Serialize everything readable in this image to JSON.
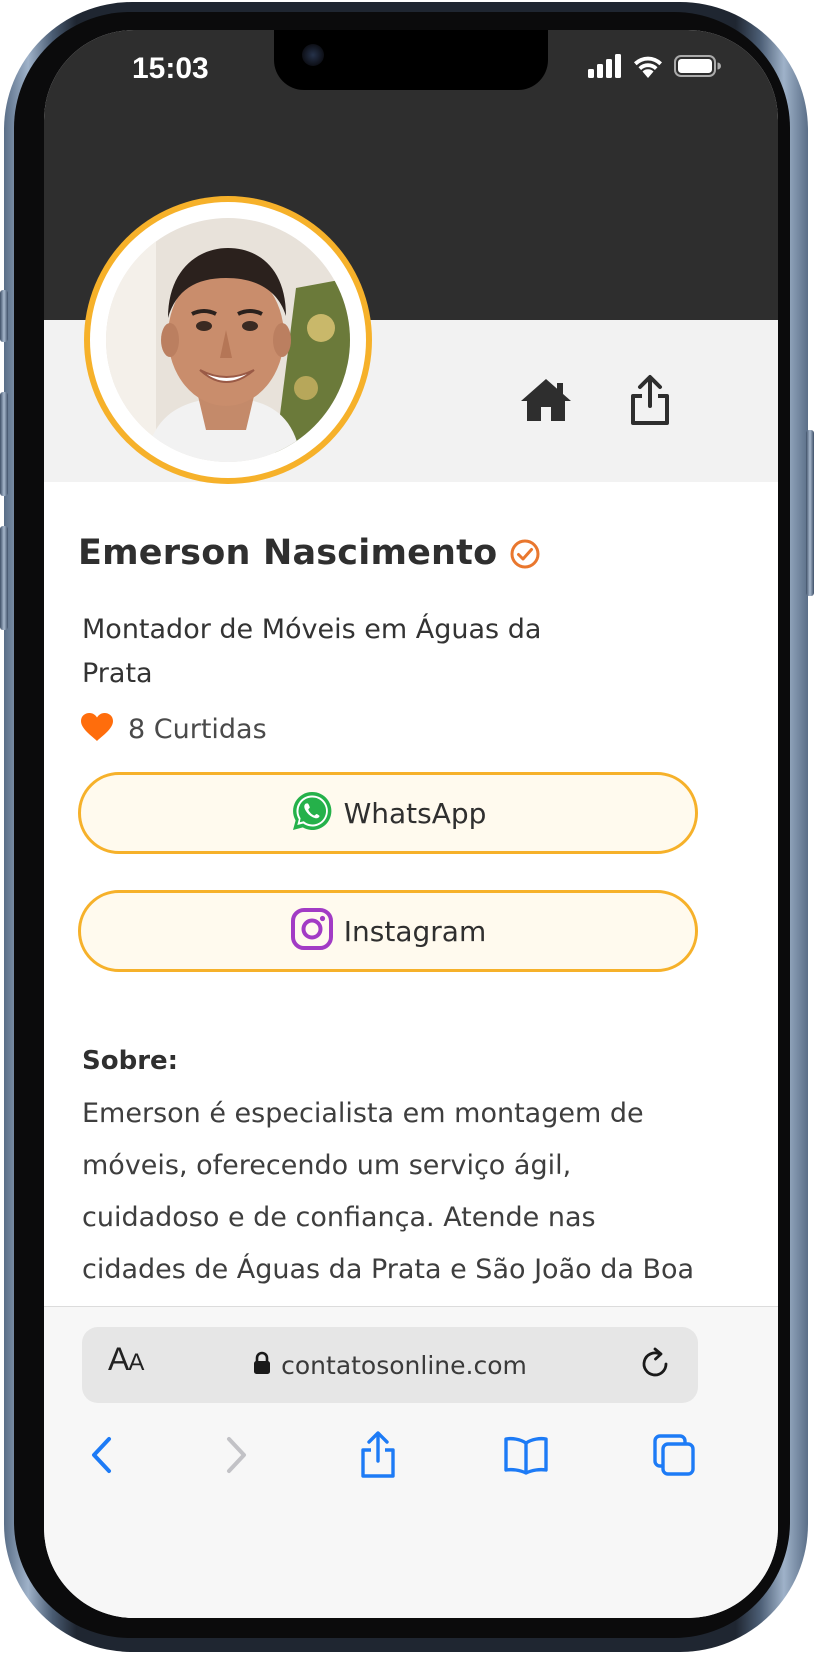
{
  "status_bar": {
    "time": "15:03"
  },
  "profile": {
    "name": "Emerson Nascimento",
    "role": "Montador de Móveis em Águas da Prata",
    "likes_label": "8 Curtidas"
  },
  "buttons": {
    "whatsapp": "WhatsApp",
    "instagram": "Instagram"
  },
  "about": {
    "title": "Sobre:",
    "text": "Emerson é especialista em montagem de móveis, oferecendo um serviço ágil, cuidadoso e de confiança. Atende nas cidades de Águas da Prata e São João da Boa Vista,"
  },
  "browser": {
    "url": "contatosonline.com",
    "text_size_label": "AA"
  },
  "colors": {
    "accent": "#f6b12a",
    "header_dark": "#2e2e2e",
    "like_heart": "#ff6d0c",
    "verified": "#e9772e",
    "whatsapp": "#25b14a",
    "instagram": "#a23bc5",
    "ios_blue": "#1d7bf6"
  },
  "icons": {
    "header": [
      "home-icon",
      "share-icon"
    ],
    "toolbar": [
      "back-icon",
      "forward-icon",
      "share-icon",
      "bookmarks-icon",
      "tabs-icon"
    ]
  }
}
